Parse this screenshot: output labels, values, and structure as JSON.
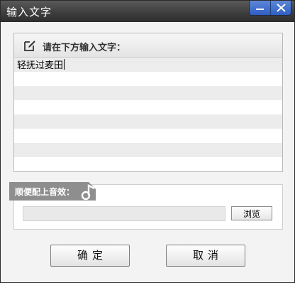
{
  "window": {
    "title": "输入文字"
  },
  "text_panel": {
    "label": "请在下方输入文字：",
    "value": "轻抚过麦田",
    "line_count": 10
  },
  "sound_panel": {
    "label": "顺便配上音效：",
    "file_value": "",
    "browse_label": "浏览"
  },
  "buttons": {
    "ok_label": "确定",
    "cancel_label": "取消"
  },
  "icons": {
    "titlebar": [
      "minimize-icon",
      "close-icon"
    ],
    "text_panel": "edit-icon",
    "sound_panel": "music-note-icon"
  },
  "colors": {
    "titlebar": "#3c3c3c",
    "window_controls": "#2f5fc4",
    "sound_tab": "#8e8e8e"
  }
}
